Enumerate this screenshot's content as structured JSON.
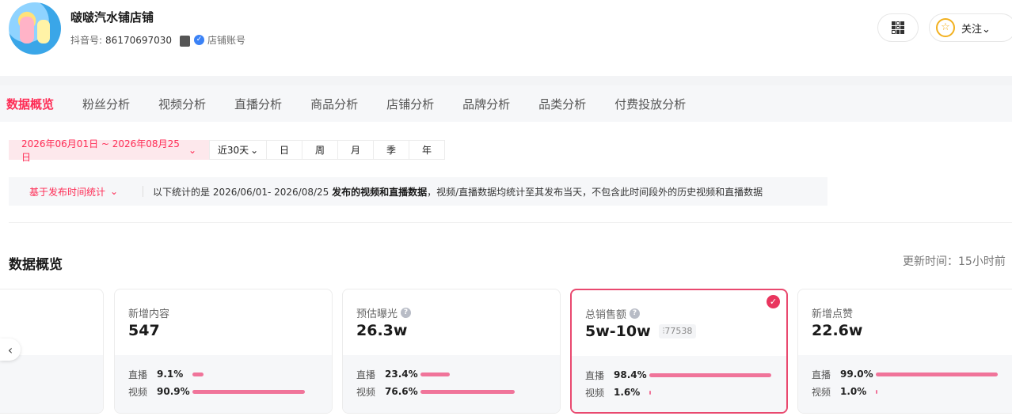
{
  "header": {
    "shop_name": "啵啵汽水铺店铺",
    "douyin_label": "抖音号:",
    "douyin_id": "86170697030",
    "account_type": "店铺账号",
    "follow_label": "关注"
  },
  "tabs": [
    {
      "label": "数据概览",
      "active": true
    },
    {
      "label": "粉丝分析"
    },
    {
      "label": "视频分析"
    },
    {
      "label": "直播分析"
    },
    {
      "label": "商品分析"
    },
    {
      "label": "店铺分析"
    },
    {
      "label": "品牌分析"
    },
    {
      "label": "品类分析"
    },
    {
      "label": "付费投放分析"
    }
  ],
  "date_filter": {
    "range": "2026年06月01日 ~ 2026年08月25日",
    "options": [
      "近30天",
      "日",
      "周",
      "月",
      "季",
      "年"
    ]
  },
  "info_bar": {
    "mode": "基于发布时间统计",
    "prefix": "以下统计的是 2026/06/01- 2026/08/25 ",
    "bold": "发布的视频和直播数据",
    "suffix": "，视频/直播数据均统计至其发布当天，不包含此时间段外的历史视频和直播数据"
  },
  "overview": {
    "title": "数据概览",
    "update_time": "更新时间：15小时前"
  },
  "cards": [
    {
      "title": "新增内容",
      "value": "547",
      "help": false,
      "selected": false,
      "rows": [
        {
          "label": "直播",
          "pct": "9.1%",
          "frac": 0.091
        },
        {
          "label": "视频",
          "pct": "90.9%",
          "frac": 0.909
        }
      ]
    },
    {
      "title": "预估曝光",
      "value": "26.3w",
      "help": true,
      "selected": false,
      "rows": [
        {
          "label": "直播",
          "pct": "23.4%",
          "frac": 0.234
        },
        {
          "label": "视频",
          "pct": "76.6%",
          "frac": 0.766
        }
      ]
    },
    {
      "title": "总销售额",
      "value": "5w-10w",
      "badge": "77538",
      "help": true,
      "selected": true,
      "rows": [
        {
          "label": "直播",
          "pct": "98.4%",
          "frac": 0.984
        },
        {
          "label": "视频",
          "pct": "1.6%",
          "frac": 0.016
        }
      ]
    },
    {
      "title": "新增点赞",
      "value": "22.6w",
      "help": false,
      "selected": false,
      "rows": [
        {
          "label": "直播",
          "pct": "99.0%",
          "frac": 0.99
        },
        {
          "label": "视频",
          "pct": "1.0%",
          "frac": 0.01
        }
      ]
    }
  ],
  "colors": {
    "accent": "#fe2c55",
    "bar": "#f0749a",
    "selected_border": "#e9496f"
  }
}
